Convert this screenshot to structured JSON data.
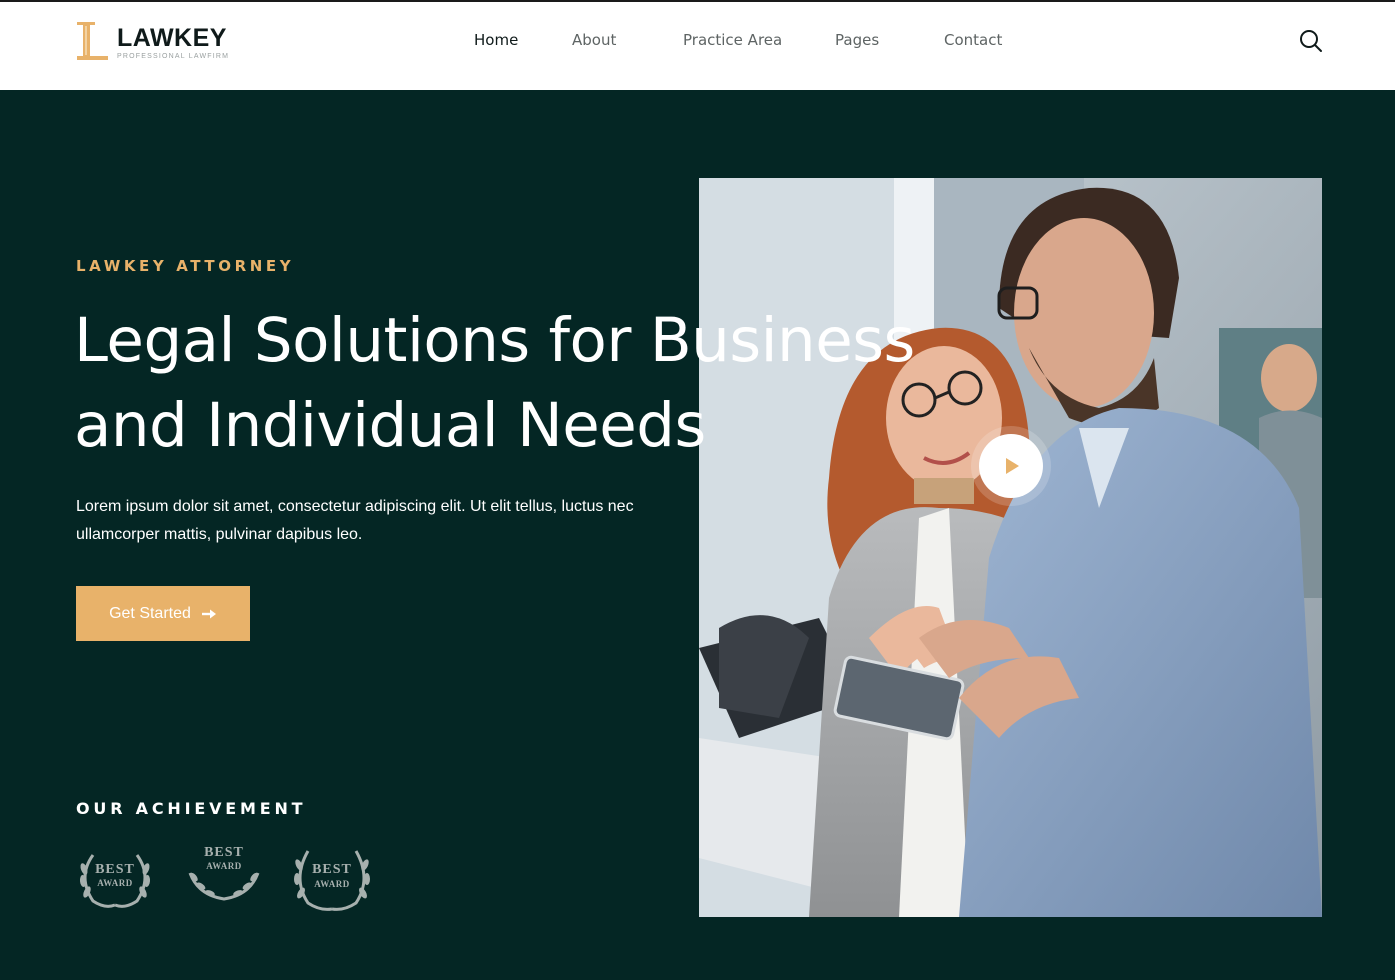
{
  "brand": {
    "name": "LAWKEY",
    "tagline": "PROFESSIONAL LAWFIRM",
    "accent_color": "#e8b26a"
  },
  "nav": {
    "items": [
      {
        "label": "Home",
        "active": true
      },
      {
        "label": "About",
        "active": false
      },
      {
        "label": "Practice Area",
        "active": false
      },
      {
        "label": "Pages",
        "active": false
      },
      {
        "label": "Contact",
        "active": false
      }
    ],
    "search_icon": "search-icon"
  },
  "hero": {
    "background_color": "#042624",
    "eyebrow": "LAWKEY ATTORNEY",
    "headline_line1": "Legal Solutions for Business",
    "headline_line2": "and Individual Needs",
    "description": "Lorem ipsum dolor sit amet, consectetur adipiscing elit. Ut elit tellus, luctus nec ullamcorper mattis, pulvinar dapibus leo.",
    "cta_label": "Get Started",
    "cta_icon": "arrow-right-icon",
    "play_icon": "play-icon"
  },
  "achievement": {
    "title": "OUR ACHIEVEMENT",
    "awards": [
      {
        "line1": "BEST",
        "line2": "AWARD"
      },
      {
        "line1": "BEST",
        "line2": "AWARD"
      },
      {
        "line1": "BEST",
        "line2": "AWARD"
      }
    ]
  }
}
